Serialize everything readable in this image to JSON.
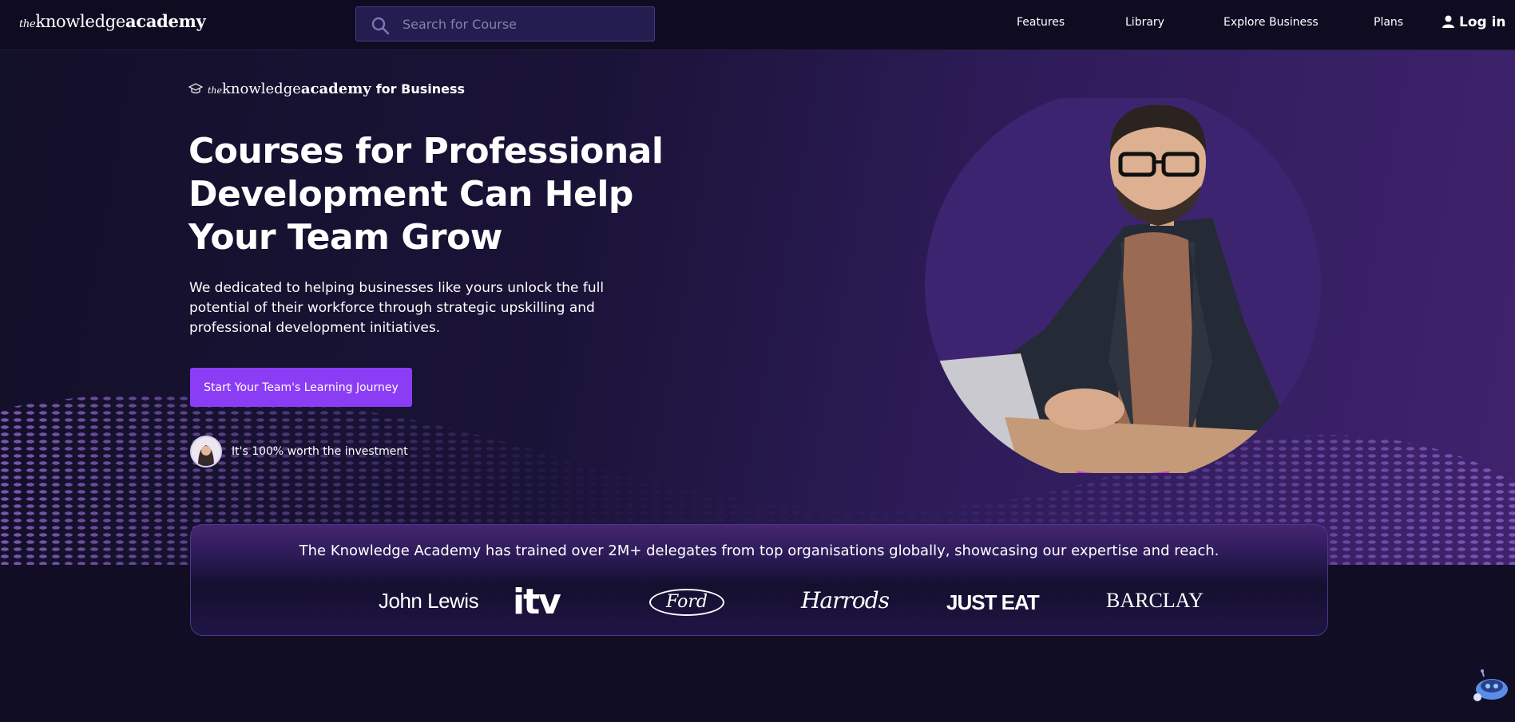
{
  "nav": {
    "logo": {
      "the": "the",
      "knowledge": "knowledge",
      "academy": "academy"
    },
    "search_placeholder": "Search for Course",
    "links": [
      "Features",
      "Library",
      "Explore Business",
      "Plans"
    ],
    "login": "Log in"
  },
  "hero": {
    "brand": {
      "the": "the",
      "knowledge": "knowledge",
      "academy": "academy",
      "suffix": "for Business"
    },
    "title": "Courses for Professional Development Can Help Your Team Grow",
    "description": "We dedicated to helping businesses like yours unlock the full potential of their workforce through strategic upskilling and professional development initiatives.",
    "cta": "Start Your Team's Learning Journey",
    "testimonial": "It's 100% worth the investment"
  },
  "trust": {
    "text": "The Knowledge Academy has trained over 2M+ delegates from top organisations globally, showcasing our expertise and reach.",
    "logos": [
      "John Lewis",
      "itv",
      "Ford",
      "Harrods",
      "JUST EAT",
      "BARCLAY"
    ]
  },
  "colors": {
    "background": "#110d24",
    "accent": "#8b3df5",
    "panel_border": "#4a3a88"
  }
}
